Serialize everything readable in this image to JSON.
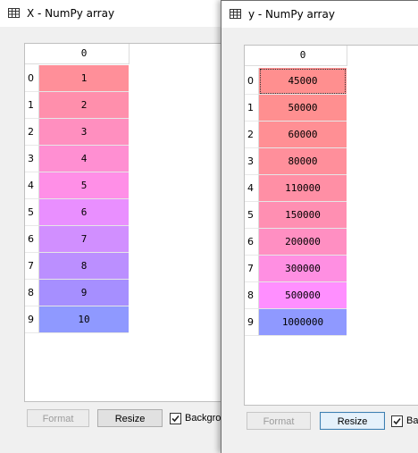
{
  "window_x": {
    "title": "X - NumPy array",
    "column_header": "0",
    "row_labels": [
      "0",
      "1",
      "2",
      "3",
      "4",
      "5",
      "6",
      "7",
      "8",
      "9"
    ],
    "values": [
      "1",
      "2",
      "3",
      "4",
      "5",
      "6",
      "7",
      "8",
      "9",
      "10"
    ],
    "cell_colors": [
      "#ff8f99",
      "#ff8fac",
      "#ff8fbf",
      "#ff8fd2",
      "#ff8fe7",
      "#e98fff",
      "#d18fff",
      "#bb8fff",
      "#a68fff",
      "#8f99ff"
    ],
    "buttons": {
      "format": "Format",
      "resize": "Resize",
      "background_label": "Backgro"
    },
    "background_checked": true
  },
  "window_y": {
    "title": "y - NumPy array",
    "column_header": "0",
    "row_labels": [
      "0",
      "1",
      "2",
      "3",
      "4",
      "5",
      "6",
      "7",
      "8",
      "9"
    ],
    "values": [
      "45000",
      "50000",
      "60000",
      "80000",
      "110000",
      "150000",
      "200000",
      "300000",
      "500000",
      "1000000"
    ],
    "cell_colors": [
      "#ff8f8f",
      "#ff8f90",
      "#ff8f94",
      "#ff8f9b",
      "#ff8fa5",
      "#ff8fb2",
      "#ff8fc2",
      "#ff8fe2",
      "#ff8fff",
      "#8f99ff"
    ],
    "selected_row": 0,
    "buttons": {
      "format": "Format",
      "resize": "Resize",
      "background_label": "Bac"
    },
    "background_checked": true
  }
}
